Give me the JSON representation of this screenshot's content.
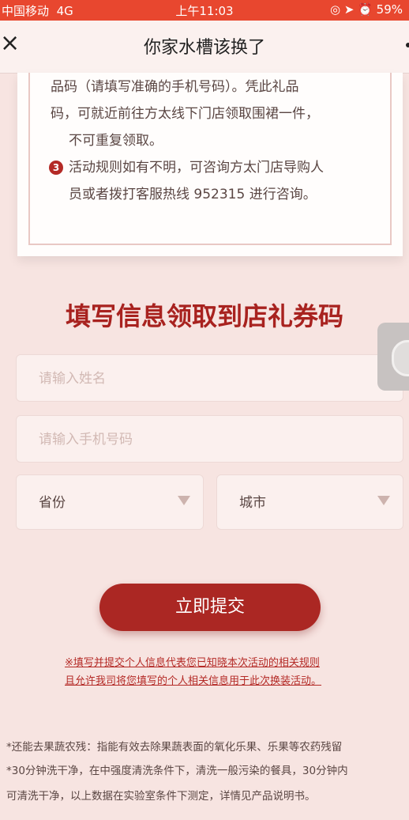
{
  "status_bar": {
    "carrier": "中国移动",
    "network": "4G",
    "time": "上午11:03",
    "battery": "59%"
  },
  "nav": {
    "close": "×",
    "title": "你家水槽该换了"
  },
  "rules": {
    "line1": "品码（请填写准确的手机号码）。凭此礼品",
    "line2": "码，可就近前往方太线下门店领取围裙一件，",
    "line3": "不可重复领取。",
    "number3": "3",
    "line4": "活动规则如有不明，可咨询方太门店导购人",
    "line5": "员或者拨打客服热线 952315 进行咨询。"
  },
  "form": {
    "heading": "填写信息领取到店礼券码",
    "name_placeholder": "请输入姓名",
    "phone_placeholder": "请输入手机号码",
    "province_label": "省份",
    "city_label": "城市",
    "submit_label": "立即提交",
    "notice_line1": "※填写并提交个人信息代表您已知晓本次活动的相关规则",
    "notice_line2": "且允许我司将您填写的个人相关信息用于此次换装活动。"
  },
  "footer": {
    "line1": "*还能去果蔬农残：指能有效去除果蔬表面的氧化乐果、乐果等农药残留",
    "line2": "*30分钟洗干净，在中强度清洗条件下，清洗一般污染的餐具，30分钟内",
    "line3": "可清洗干净，以上数据在实验室条件下测定，详情见产品说明书。"
  }
}
